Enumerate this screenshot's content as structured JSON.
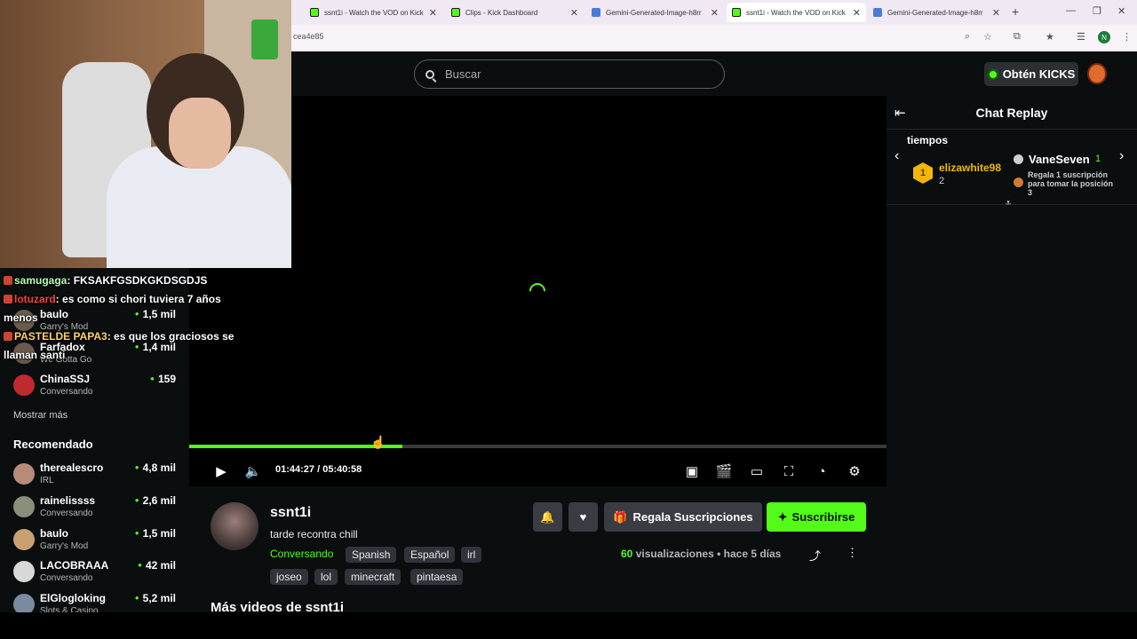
{
  "browser": {
    "tabs": [
      {
        "title": "ssnt1i - Watch the VOD on Kick",
        "active": false,
        "favicon": "kick-icon"
      },
      {
        "title": "Clips - Kick Dashboard",
        "active": false,
        "favicon": "kick-icon"
      },
      {
        "title": "Gemini-Generated-Image-h8rr",
        "active": false,
        "favicon": "image-icon"
      },
      {
        "title": "ssnt1i - Watch the VOD on Kick",
        "active": true,
        "favicon": "kick-icon"
      },
      {
        "title": "Gemini-Generated-Image-h8rr",
        "active": false,
        "favicon": "image-icon"
      }
    ],
    "url": "cea4e85",
    "profile_initial": "N"
  },
  "header": {
    "search_placeholder": "Buscar",
    "get_kicks_label": "Obtén KICKS"
  },
  "stream_chat_overlay": [
    {
      "user": "samugaga",
      "text": "FKSAKFGSDKGKDSGDJS"
    },
    {
      "user": "lotuzard",
      "text": "es como si chori tuviera 7 años menos"
    },
    {
      "user": "PASTELDE PAPA3",
      "text": "es que los graciosos se llaman santi"
    }
  ],
  "sidebar": {
    "following": [
      {
        "name": "baulo",
        "category": "Garry's Mod",
        "viewers": "1,5 mil"
      },
      {
        "name": "Farfadox",
        "category": "We Gotta Go",
        "viewers": "1,4 mil"
      },
      {
        "name": "ChinaSSJ",
        "category": "Conversando",
        "viewers": "159"
      }
    ],
    "show_more": "Mostrar más",
    "recommended_title": "Recomendado",
    "recommended": [
      {
        "name": "therealescro",
        "category": "IRL",
        "viewers": "4,8 mil"
      },
      {
        "name": "rainelissss",
        "category": "Conversando",
        "viewers": "2,6 mil"
      },
      {
        "name": "baulo",
        "category": "Garry's Mod",
        "viewers": "1,5 mil"
      },
      {
        "name": "LACOBRAAA",
        "category": "Conversando",
        "viewers": "42 mil"
      },
      {
        "name": "ElGlogloking",
        "category": "Slots & Casino",
        "viewers": "5,2 mil"
      }
    ]
  },
  "player": {
    "current_time": "01:44:27",
    "separator": "/",
    "duration": "05:40:58",
    "progress_fraction": 0.306
  },
  "stream": {
    "streamer": "ssnt1i",
    "title": "tarde recontra chill",
    "category": "Conversando",
    "tags": [
      "Spanish",
      "Español",
      "irl",
      "joseo",
      "lol",
      "minecraft",
      "pintaesa"
    ],
    "gift_label": "Regala Suscripciones",
    "subscribe_label": "Suscribirse",
    "views_count": "60",
    "views_label": "visualizaciones",
    "ago": "hace 5 días",
    "more_videos": "Más videos de ssnt1i"
  },
  "chat_replay": {
    "title": "Chat Replay",
    "leaderboard_caption": "tiempos",
    "first": {
      "rank": "1",
      "name": "elizawhite98",
      "count": "2"
    },
    "second": {
      "name": "VaneSeven",
      "count": "1"
    },
    "third_text": "Regala 1 suscripción para tomar la posición 3"
  },
  "colors": {
    "accent": "#53fc18",
    "background": "#0b0e0f",
    "button_gray": "#393c42",
    "gold": "#f2b705"
  }
}
